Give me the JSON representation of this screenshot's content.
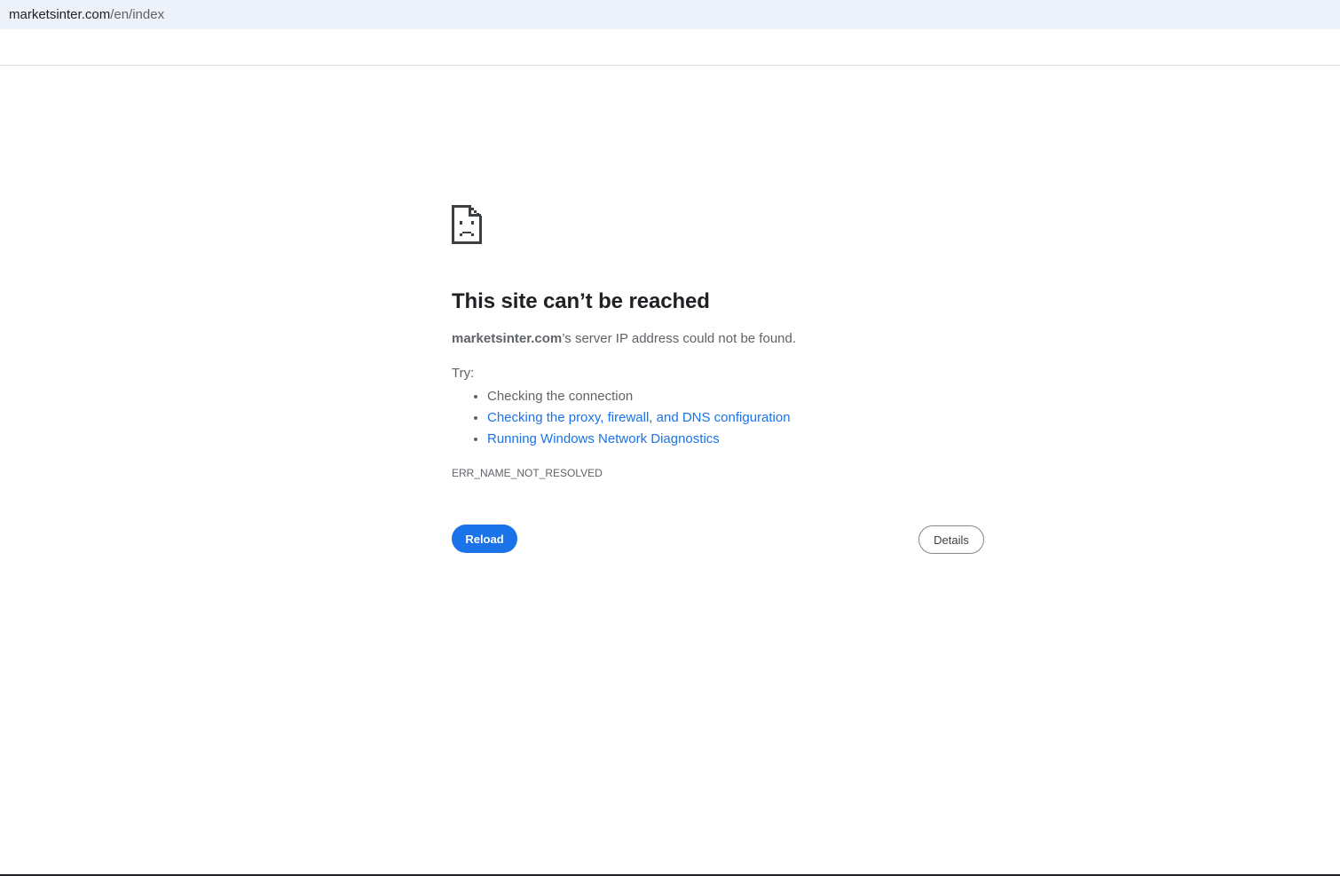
{
  "address_bar": {
    "host": "marketsinter.com",
    "path": "/en/index"
  },
  "error": {
    "icon": "sad-page-icon",
    "title": "This site can’t be reached",
    "message_host": "marketsinter.com",
    "message_rest": "’s server IP address could not be found.",
    "try_label": "Try:",
    "suggestions": [
      "Checking the connection",
      "Checking the proxy, firewall, and DNS configuration",
      "Running Windows Network Diagnostics"
    ],
    "code": "ERR_NAME_NOT_RESOLVED"
  },
  "buttons": {
    "reload_label": "Reload",
    "details_label": "Details"
  },
  "colors": {
    "link": "#1a73e8",
    "primary_button": "#1a73e8",
    "address_bar_bg": "#edf2fa",
    "text_secondary": "#5f6368"
  }
}
